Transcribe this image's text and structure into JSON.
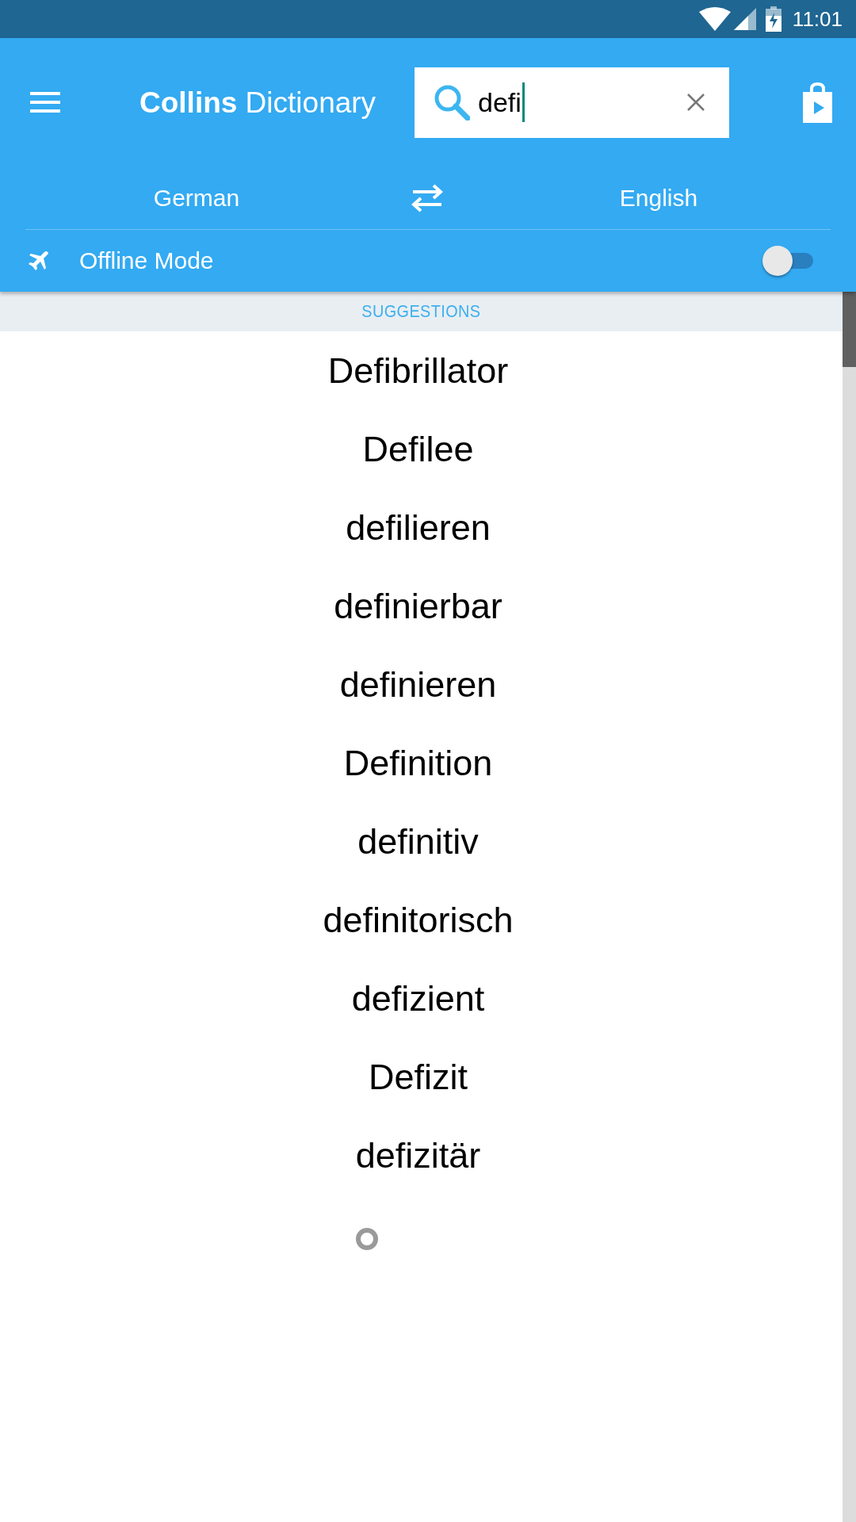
{
  "status_bar": {
    "time": "11:01"
  },
  "app_bar": {
    "title": "**Collins** Dictionary",
    "search": {
      "value": "defi"
    }
  },
  "languages": {
    "source": "German",
    "target": "English"
  },
  "offline_mode": {
    "label": "Offline Mode",
    "on": false
  },
  "suggestions": {
    "heading": "SUGGESTIONS",
    "items": [
      "Defibrillator",
      "Defilee",
      "defilieren",
      "definierbar",
      "definieren",
      "Definition",
      "definitiv",
      "definitorisch",
      "defizient",
      "Defizit",
      "defizitär"
    ],
    "loading": true
  }
}
